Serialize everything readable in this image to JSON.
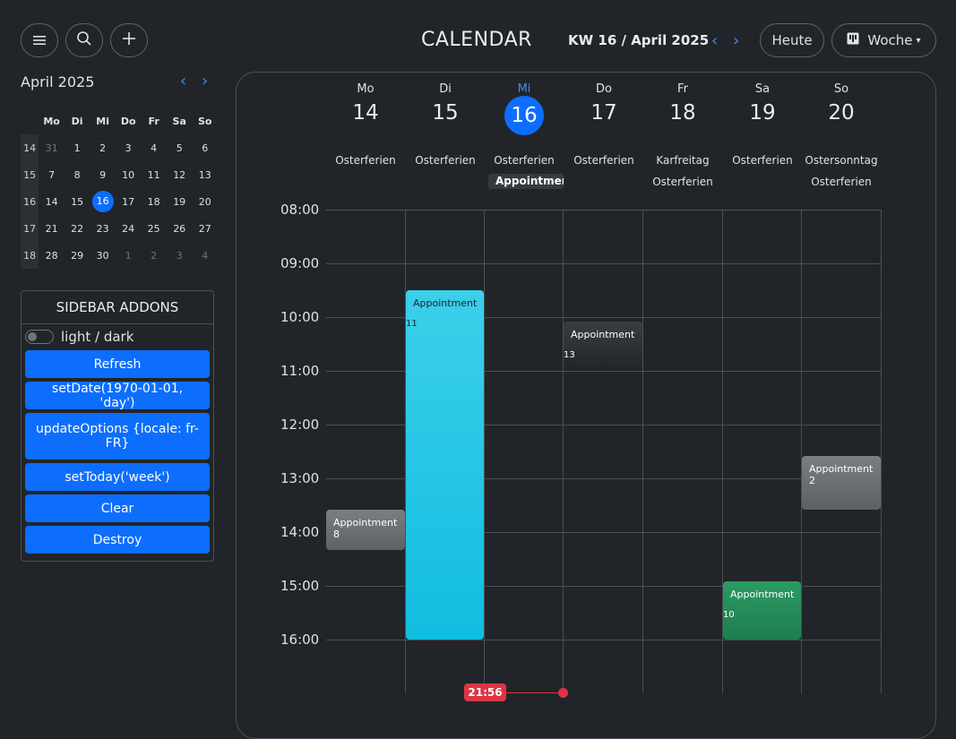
{
  "header": {
    "title": "CALENDAR",
    "week_label": "KW 16 / April 2025",
    "today_label": "Heute",
    "view_label": "Woche"
  },
  "mini": {
    "title": "April 2025",
    "weekdays": [
      "Mo",
      "Di",
      "Mi",
      "Do",
      "Fr",
      "Sa",
      "So"
    ],
    "weeks": [
      {
        "kw": "14",
        "days": [
          "31",
          "1",
          "2",
          "3",
          "4",
          "5",
          "6"
        ]
      },
      {
        "kw": "15",
        "days": [
          "7",
          "8",
          "9",
          "10",
          "11",
          "12",
          "13"
        ]
      },
      {
        "kw": "16",
        "days": [
          "14",
          "15",
          "16",
          "17",
          "18",
          "19",
          "20"
        ]
      },
      {
        "kw": "17",
        "days": [
          "21",
          "22",
          "23",
          "24",
          "25",
          "26",
          "27"
        ]
      },
      {
        "kw": "18",
        "days": [
          "28",
          "29",
          "30",
          "1",
          "2",
          "3",
          "4"
        ]
      }
    ]
  },
  "addons": {
    "title": "SIDEBAR ADDONS",
    "toggle_label": "light / dark",
    "buttons": [
      "Refresh",
      "setDate(1970-01-01, 'day')",
      "updateOptions {locale: fr-FR}",
      "setToday('week')",
      "Clear",
      "Destroy"
    ]
  },
  "week": {
    "days": [
      {
        "name": "Mo",
        "num": "14",
        "allday": [
          "Osterferien"
        ]
      },
      {
        "name": "Di",
        "num": "15",
        "allday": [
          "Osterferien"
        ]
      },
      {
        "name": "Mi",
        "num": "16",
        "allday": [
          "Osterferien",
          "Appointment"
        ]
      },
      {
        "name": "Do",
        "num": "17",
        "allday": [
          "Osterferien"
        ]
      },
      {
        "name": "Fr",
        "num": "18",
        "allday": [
          "Karfreitag",
          "Osterferien"
        ]
      },
      {
        "name": "Sa",
        "num": "19",
        "allday": [
          "Osterferien"
        ]
      },
      {
        "name": "So",
        "num": "20",
        "allday": [
          "Ostersonntag",
          "Osterferien"
        ]
      }
    ],
    "hours": [
      "08:00",
      "09:00",
      "10:00",
      "11:00",
      "12:00",
      "13:00",
      "14:00",
      "15:00",
      "16:00"
    ],
    "events": [
      {
        "title": "Appointment",
        "num": "11",
        "day": "Di",
        "start": "09:30",
        "end": "16:00",
        "color": "#2ec6e6"
      },
      {
        "title": "Appointment",
        "num": "13",
        "day": "Do",
        "start": "10:05",
        "end": "11:00",
        "color": "#34373b"
      },
      {
        "title": "Appointment 8",
        "num": "",
        "day": "Mo",
        "start": "13:35",
        "end": "14:20",
        "color": "#6c7176"
      },
      {
        "title": "Appointment 2",
        "num": "",
        "day": "So",
        "start": "12:45",
        "end": "13:35",
        "color": "#6c7176"
      },
      {
        "title": "Appointment",
        "num": "10",
        "day": "Sa",
        "start": "14:55",
        "end": "16:00",
        "color": "#218a55"
      }
    ],
    "now": "21:56"
  }
}
